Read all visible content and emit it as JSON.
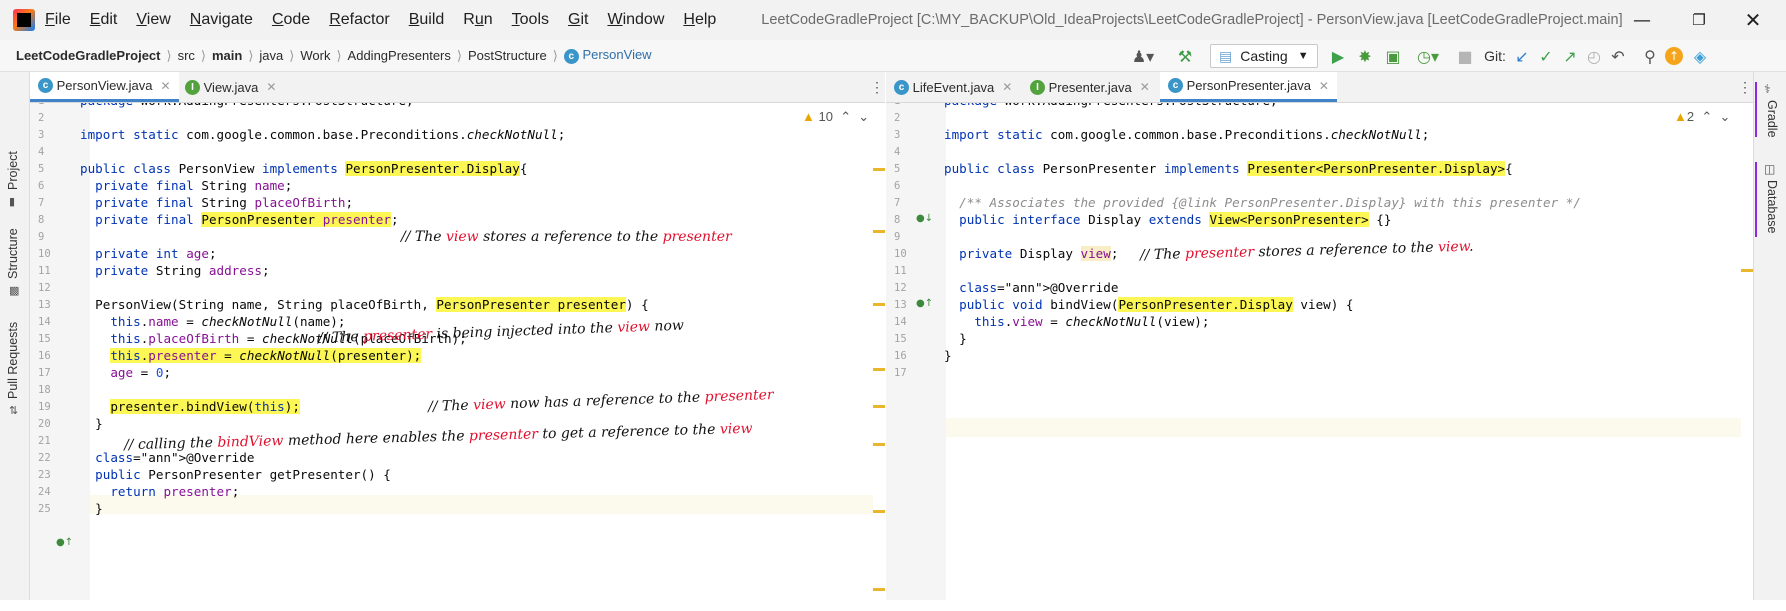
{
  "menu": {
    "items": [
      "File",
      "Edit",
      "View",
      "Navigate",
      "Code",
      "Refactor",
      "Build",
      "Run",
      "Tools",
      "Git",
      "Window",
      "Help"
    ],
    "underline": [
      "F",
      "E",
      "V",
      "N",
      "C",
      "R",
      "B",
      "u",
      "T",
      "G",
      "W",
      "H"
    ],
    "window_title": "LeetCodeGradleProject [C:\\MY_BACKUP\\Old_IdeaProjects\\LeetCodeGradleProject] - PersonView.java [LeetCodeGradleProject.main]"
  },
  "breadcrumb": [
    "LeetCodeGradleProject",
    "src",
    "main",
    "java",
    "Work",
    "AddingPresenters",
    "PostStructure",
    "PersonView"
  ],
  "toolbar": {
    "run_config": "Casting",
    "git_label": "Git:"
  },
  "sidebar_left": [
    "Project",
    "Structure",
    "Pull Requests"
  ],
  "sidebar_right": [
    "Gradle",
    "Database"
  ],
  "left_pane": {
    "tabs": [
      "PersonView.java",
      "View.java"
    ],
    "warnings": "10",
    "lines": [
      "package Work.AddingPresenters.PostStructure;",
      "",
      "import static com.google.common.base.Preconditions.checkNotNull;",
      "",
      "public class PersonView implements PersonPresenter.Display{",
      "  private final String name;",
      "  private final String placeOfBirth;",
      "  private final PersonPresenter presenter;",
      "",
      "  private int age;",
      "  private String address;",
      "",
      "  PersonView(String name, String placeOfBirth, PersonPresenter presenter) {",
      "    this.name = checkNotNull(name);",
      "    this.placeOfBirth = checkNotNull(placeOfBirth);",
      "    this.presenter = checkNotNull(presenter);",
      "    age = 0;",
      "",
      "    presenter.bindView(this);",
      "  }",
      "",
      "  @Override",
      "  public PersonPresenter getPresenter() {",
      "    return presenter;",
      "  }"
    ],
    "handwritten": [
      "// The view stores a reference to the presenter",
      "// The presenter is being injected into the view now",
      "// The view now has a reference to the presenter",
      "// calling the bindView method here enables the presenter to get a reference to the view"
    ]
  },
  "right_pane": {
    "tabs": [
      "LifeEvent.java",
      "Presenter.java",
      "PersonPresenter.java"
    ],
    "warnings": "2",
    "lines": [
      "package Work.AddingPresenters.PostStructure;",
      "",
      "import static com.google.common.base.Preconditions.checkNotNull;",
      "",
      "public class PersonPresenter implements Presenter<PersonPresenter.Display>{",
      "",
      "  /** Associates the provided {@link PersonPresenter.Display} with this presenter */",
      "  public interface Display extends View<PersonPresenter> {}",
      "",
      "  private Display view;",
      "",
      "  @Override",
      "  public void bindView(PersonPresenter.Display view) {",
      "    this.view = checkNotNull(view);",
      "  }",
      "}",
      ""
    ],
    "handwritten": [
      "// The presenter stores a reference to the view."
    ]
  }
}
